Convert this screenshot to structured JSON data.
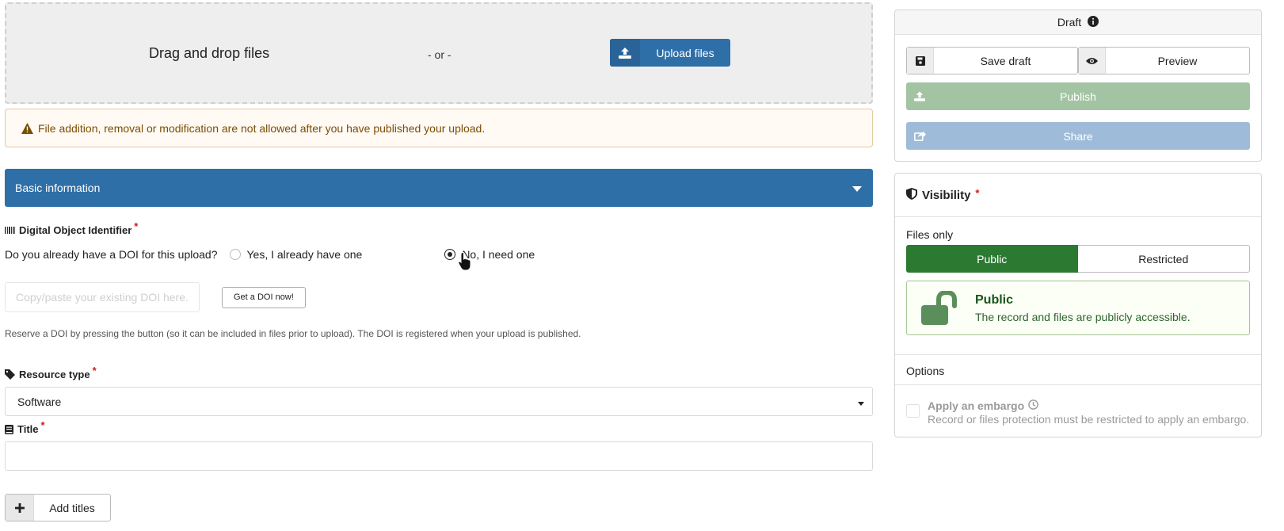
{
  "upload": {
    "drag_text": "Drag and drop files",
    "or_text": "- or -",
    "upload_button": "Upload files",
    "warning": "File addition, removal or modification are not allowed after you have published your upload."
  },
  "section": {
    "title": "Basic information"
  },
  "doi": {
    "label": "Digital Object Identifier",
    "required_mark": "*",
    "question": "Do you already have a DOI for this upload?",
    "option_yes": "Yes, I already have one",
    "option_no": "No, I need one",
    "selected": "no",
    "input_placeholder": "Copy/paste your existing DOI here.",
    "get_button": "Get a DOI now!",
    "help": "Reserve a DOI by pressing the button (so it can be included in files prior to upload). The DOI is registered when your upload is published."
  },
  "resource_type": {
    "label": "Resource type",
    "required_mark": "*",
    "value": "Software"
  },
  "title_field": {
    "label": "Title",
    "required_mark": "*",
    "value": "",
    "add_titles": "Add titles"
  },
  "draft": {
    "status": "Draft",
    "save_draft": "Save draft",
    "preview": "Preview",
    "publish": "Publish",
    "share": "Share"
  },
  "visibility": {
    "title": "Visibility",
    "required_mark": "*",
    "files_only": "Files only",
    "public": "Public",
    "restricted": "Restricted",
    "selected": "public",
    "box_title": "Public",
    "box_desc": "The record and files are publicly accessible.",
    "options": "Options",
    "embargo_title": "Apply an embargo",
    "embargo_desc": "Record or files protection must be restricted to apply an embargo."
  },
  "colors": {
    "primary_blue": "#2f6fa8",
    "public_green": "#2c7a32",
    "publish_green_disabled": "#a3c4a3",
    "share_blue_disabled": "#9ebcd9",
    "required_red": "#d01919"
  },
  "icons": {
    "upload": "upload-icon",
    "warning": "warning-icon",
    "dropdown": "caret-down-icon",
    "barcode": "barcode-icon",
    "tag": "tag-icon",
    "book": "book-icon",
    "plus": "plus-icon",
    "info": "info-icon",
    "save": "save-icon",
    "eye": "eye-icon",
    "share": "share-icon",
    "shield": "shield-icon",
    "unlock": "unlock-icon",
    "clock": "clock-icon",
    "cursor": "hand-cursor-icon"
  }
}
